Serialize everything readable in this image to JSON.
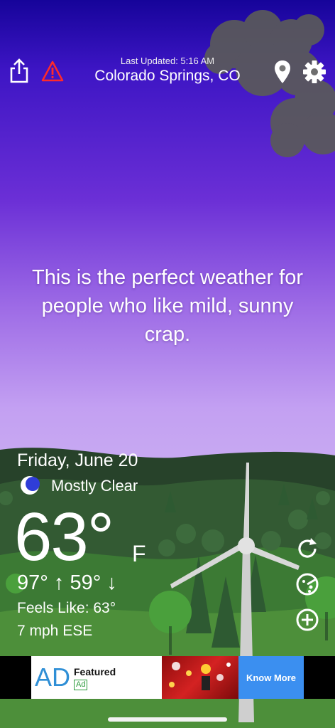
{
  "header": {
    "last_updated": "Last Updated: 5:16 AM",
    "location": "Colorado Springs, CO",
    "share_icon": "share-icon",
    "alert_icon": "warning-icon",
    "location_icon": "location-pin-icon",
    "settings_icon": "gear-icon"
  },
  "message": "This is the perfect weather for people who like mild, sunny crap.",
  "weather": {
    "date": "Friday, June 20",
    "condition": "Mostly Clear",
    "condition_icon": "moon-icon",
    "temperature": "63°",
    "unit": "F",
    "hi_lo": "97° ↑  59° ↓",
    "feels_like": "Feels Like: 63°",
    "wind": "7 mph ESE"
  },
  "side_buttons": [
    "refresh-icon",
    "radar-icon",
    "add-icon"
  ],
  "ad": {
    "logo": "AD",
    "title": "Featured",
    "tag": "Ad",
    "cta": "Know More"
  },
  "colors": {
    "sky_top": "#16049a",
    "sky_bottom": "#cbb0f2",
    "ad_cta": "#3b8ff0"
  }
}
